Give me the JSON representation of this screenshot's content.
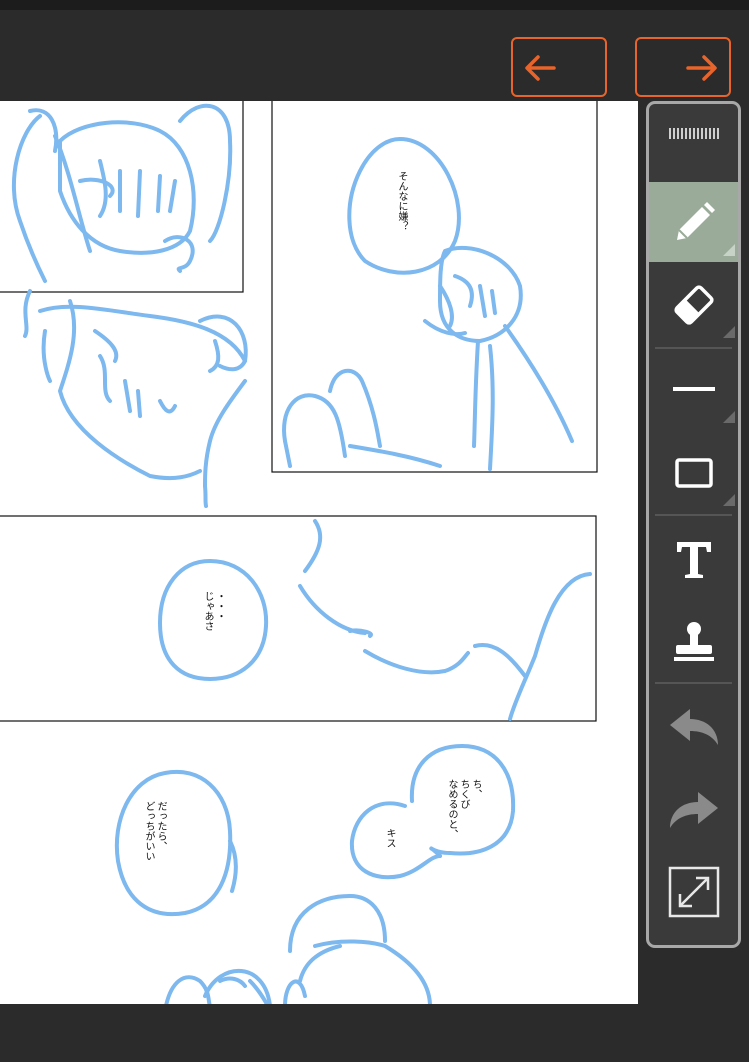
{
  "colors": {
    "accent": "#e8642a",
    "sketch": "#7db8ef",
    "panel_active": "#9aab9a",
    "canvas": "#ffffff",
    "chrome": "#2b2b2b"
  },
  "nav": {
    "prev_icon": "arrow-left-icon",
    "next_icon": "arrow-right-icon"
  },
  "speech": {
    "bubble1": "そんなに嫌？",
    "bubble2": "・・・\nじゃあさ",
    "bubble3": "だったら、\nどっちがいい",
    "bubble4": "ち、\nちくび\nなめるのと、",
    "bubble5": "キス"
  },
  "tools": [
    {
      "name": "pen",
      "icon": "pencil-icon",
      "active": true
    },
    {
      "name": "eraser",
      "icon": "eraser-icon",
      "active": false
    },
    {
      "name": "line",
      "icon": "line-icon",
      "active": false
    },
    {
      "name": "rectangle",
      "icon": "rectangle-icon",
      "active": false
    },
    {
      "name": "text",
      "icon": "text-icon",
      "active": false
    },
    {
      "name": "stamp",
      "icon": "stamp-icon",
      "active": false
    },
    {
      "name": "undo",
      "icon": "undo-icon",
      "active": false
    },
    {
      "name": "redo",
      "icon": "redo-icon",
      "active": false
    },
    {
      "name": "fullscreen",
      "icon": "expand-icon",
      "active": false
    }
  ]
}
